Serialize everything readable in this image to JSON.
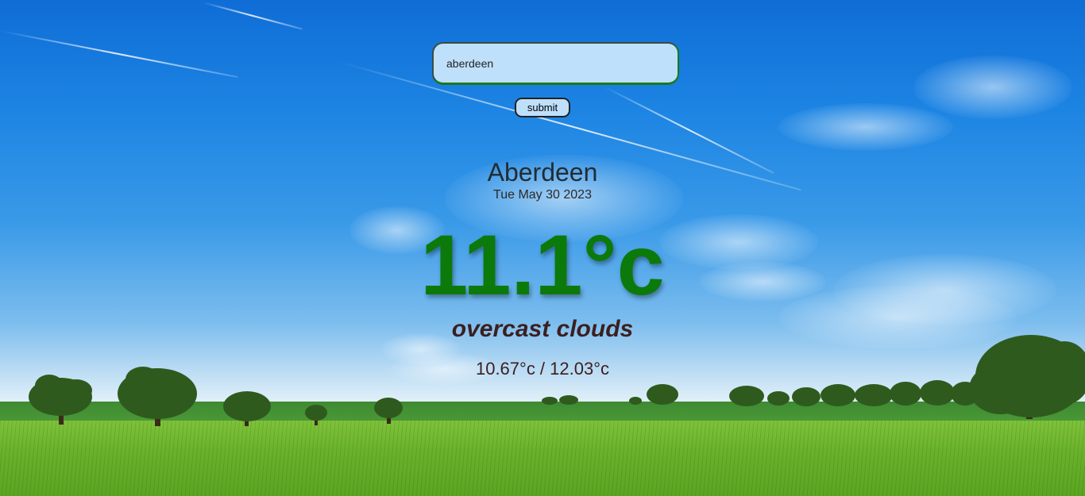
{
  "search": {
    "value": "aberdeen",
    "submit_label": "submit"
  },
  "weather": {
    "city": "Aberdeen",
    "date": "Tue May 30 2023",
    "temperature": "11.1°c",
    "description": "overcast clouds",
    "min_max": "10.67°c / 12.03°c"
  },
  "colors": {
    "temperature": "#0b7a0b",
    "description": "#3b1f1f",
    "input_background": "#bfe0fb"
  }
}
